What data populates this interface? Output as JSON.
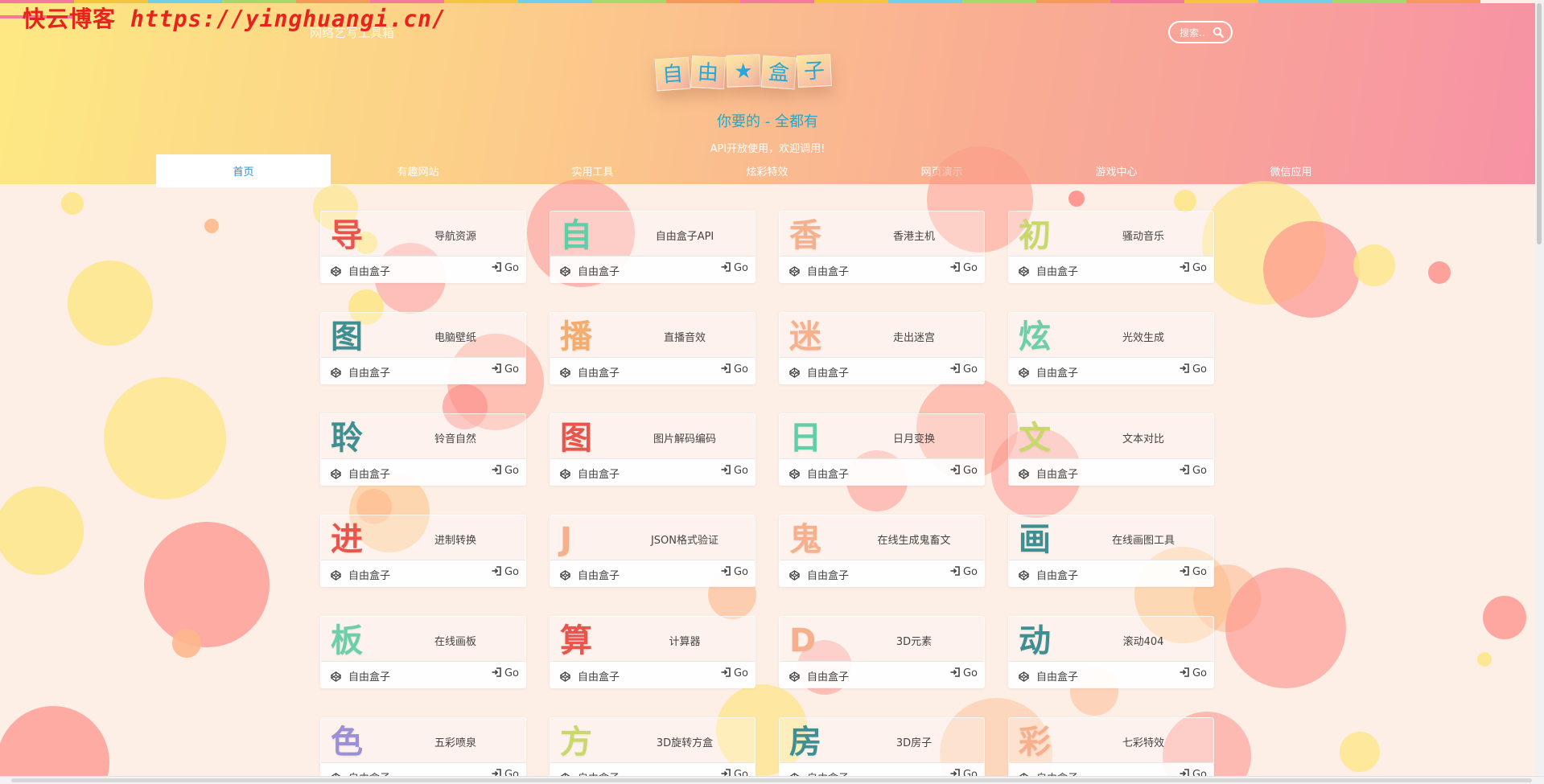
{
  "watermark": {
    "name": "快云博客",
    "url": "https://yinghuangi.cn/"
  },
  "header": {
    "site_name": "网络艺写工具箱",
    "logo_chars": [
      "自",
      "由",
      "★",
      "盒",
      "子"
    ],
    "slogan": "你要的 - 全都有",
    "sub_slogan": "API开放使用，欢迎调用!"
  },
  "search": {
    "placeholder": "搜索..",
    "icon": "search-icon"
  },
  "nav": {
    "tabs": [
      "首页",
      "有趣网站",
      "实用工具",
      "炫彩特效",
      "网页演示",
      "游戏中心",
      "微信应用"
    ],
    "active_index": 0
  },
  "card_common": {
    "brand": "自由盒子",
    "brand_icon": "codepen-icon",
    "go_label": "Go",
    "go_icon": "login-icon"
  },
  "cards": [
    {
      "glyph": "导",
      "title": "导航资源",
      "color": "#e9554b"
    },
    {
      "glyph": "自",
      "title": "自由盒子API",
      "color": "#5fcfa7"
    },
    {
      "glyph": "香",
      "title": "香港主机",
      "color": "#f6b08c"
    },
    {
      "glyph": "初",
      "title": "骚动音乐",
      "color": "#c8d86b"
    },
    {
      "glyph": "图",
      "title": "电脑壁纸",
      "color": "#3e8f92"
    },
    {
      "glyph": "播",
      "title": "直播音效",
      "color": "#f4ad6c"
    },
    {
      "glyph": "迷",
      "title": "走出迷宫",
      "color": "#f6b08c"
    },
    {
      "glyph": "炫",
      "title": "光效生成",
      "color": "#6ccfa9"
    },
    {
      "glyph": "聆",
      "title": "铃音自然",
      "color": "#3e8f92"
    },
    {
      "glyph": "图",
      "title": "图片解码编码",
      "color": "#e9554b"
    },
    {
      "glyph": "日",
      "title": "日月变换",
      "color": "#5fcfa7"
    },
    {
      "glyph": "文",
      "title": "文本对比",
      "color": "#c8d86b"
    },
    {
      "glyph": "进",
      "title": "进制转换",
      "color": "#e9554b"
    },
    {
      "glyph": "J",
      "title": "JSON格式验证",
      "color": "#f6b08c"
    },
    {
      "glyph": "鬼",
      "title": "在线生成鬼畜文",
      "color": "#f6b08c"
    },
    {
      "glyph": "画",
      "title": "在线画图工具",
      "color": "#3e8f92"
    },
    {
      "glyph": "板",
      "title": "在线画板",
      "color": "#6ccfa9"
    },
    {
      "glyph": "算",
      "title": "计算器",
      "color": "#e9554b"
    },
    {
      "glyph": "D",
      "title": "3D元素",
      "color": "#f6b08c"
    },
    {
      "glyph": "动",
      "title": "滚动404",
      "color": "#3e8f92"
    },
    {
      "glyph": "色",
      "title": "五彩喷泉",
      "color": "#9b8fd8"
    },
    {
      "glyph": "方",
      "title": "3D旋转方盒",
      "color": "#c8d86b"
    },
    {
      "glyph": "房",
      "title": "3D房子",
      "color": "#3e8f92"
    },
    {
      "glyph": "彩",
      "title": "七彩特效",
      "color": "#f6b08c"
    }
  ]
}
